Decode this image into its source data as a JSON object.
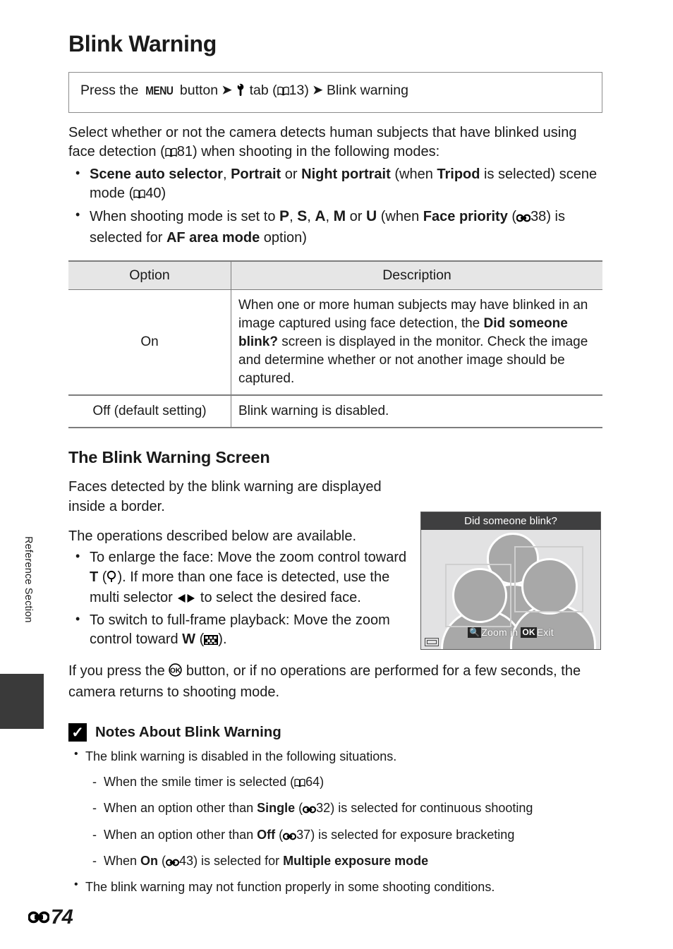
{
  "side": {
    "vertical_label": "Reference Section"
  },
  "header": {
    "title": "Blink Warning"
  },
  "menu_path": {
    "press_the": "Press the",
    "menu_button_label": "MENU",
    "button_word": "button",
    "arrow": "➜",
    "tab_icon": "wrench-setup-tab-icon",
    "tab_word": "tab",
    "ref_open": "(",
    "book_icon": "book-reference-icon",
    "ref_page": "13",
    "ref_close": ")",
    "destination": "Blink warning"
  },
  "intro": {
    "line1": "Select whether or not the camera detects human subjects that have blinked",
    "line2_a": "using face detection (",
    "line2_ref": "81",
    "line2_b": ") when shooting in the following modes:"
  },
  "mode_bullets": [
    {
      "b1": "Scene auto selector",
      "sep1": ", ",
      "b2": "Portrait",
      "sep2": " or ",
      "b3": "Night portrait",
      "mid": " (when ",
      "b4": "Tripod",
      "tail_a": " is selected) scene mode (",
      "tail_ref": "40",
      "tail_b": ")"
    },
    {
      "lead": "When shooting mode is set to ",
      "modes": [
        "P",
        "S",
        "A",
        "M"
      ],
      "or_word": " or ",
      "mode_u": "U",
      "mid": " (when ",
      "bold1": "Face priority",
      "tail_a": " (",
      "tail_ref": "38",
      "tail_b": ") is selected for ",
      "bold2": "AF area mode",
      "tail_c": " option)"
    }
  ],
  "table": {
    "headers": [
      "Option",
      "Description"
    ],
    "rows": [
      {
        "option": "On",
        "description_parts": [
          {
            "text": "When one or more human subjects may have blinked in an image captured using face detection, the ",
            "bold": false
          },
          {
            "text": "Did someone blink?",
            "bold": true
          },
          {
            "text": " screen is displayed in the monitor.",
            "bold": false
          },
          {
            "text": "\nCheck the image and determine whether or not another image should be captured.",
            "bold": false
          }
        ],
        "desc_line1": "When one or more human subjects may have blinked in an",
        "desc_line2_a": "image captured using face detection, the ",
        "desc_bold1": "Did someone",
        "desc_bold2": "blink?",
        "desc_line3": " screen is displayed in the monitor.",
        "desc_line4": "Check the image and determine whether or not another",
        "desc_line5": "image should be captured."
      },
      {
        "option": "Off (default setting)",
        "description": "Blink warning is disabled."
      }
    ]
  },
  "screen_section": {
    "heading": "The Blink Warning Screen",
    "para1": "Faces detected by the blink warning are displayed inside a border.",
    "para2": "The operations described below are available.",
    "bullets": [
      {
        "a": "To enlarge the face: Move the zoom control toward ",
        "key": "T",
        "icon": "magnifier-zoom-in-icon",
        "b": ". If more than one face is detected, use the multi selector ",
        "icon2": "left-right-arrows-icon",
        "c": " to select the desired face."
      },
      {
        "a": "To switch to full-frame playback: Move the zoom control toward ",
        "key": "W",
        "icon": "thumbnail-grid-icon",
        "b": "."
      }
    ],
    "closing_a": "If you press the ",
    "closing_ok_icon": "ok-button-icon",
    "closing_b": " button, or if no operations are performed for a few seconds, the camera returns to shooting mode."
  },
  "camera_screen": {
    "title": "Did someone blink?",
    "hint_zoom_icon": "magnifier-icon",
    "hint_zoom_label": "Zoom in",
    "hint_ok_label": "OK",
    "hint_exit_label": "Exit",
    "battery_icon": "battery-level-icon",
    "colors": {
      "title_bar": "#3f3f40",
      "background": "#e2e2e3",
      "subject": "#a8a8a8",
      "face_box": "#cfcfcf"
    }
  },
  "notes": {
    "icon": "checkmark-note-icon",
    "title": "Notes About Blink Warning",
    "items": [
      {
        "text": "The blink warning is disabled in the following situations.",
        "sub": [
          {
            "a": "When the smile timer is selected (",
            "ref_type": "book",
            "ref": "64",
            "b": ")"
          },
          {
            "a": "When an option other than ",
            "bold": "Single",
            "b": " (",
            "ref_type": "e",
            "ref": "32",
            "c": ") is selected for continuous shooting"
          },
          {
            "a": "When an option other than ",
            "bold": "Off",
            "b": " (",
            "ref_type": "e",
            "ref": "37",
            "c": ") is selected for exposure bracketing"
          },
          {
            "a": "When ",
            "bold": "On",
            "b": " (",
            "ref_type": "e",
            "ref": "43",
            "c": ") is selected for ",
            "bold2": "Multiple exposure mode"
          }
        ]
      },
      {
        "text": "The blink warning may not function properly in some shooting conditions."
      }
    ]
  },
  "footer": {
    "section_icon": "e-section-icon",
    "page_number": "74"
  }
}
